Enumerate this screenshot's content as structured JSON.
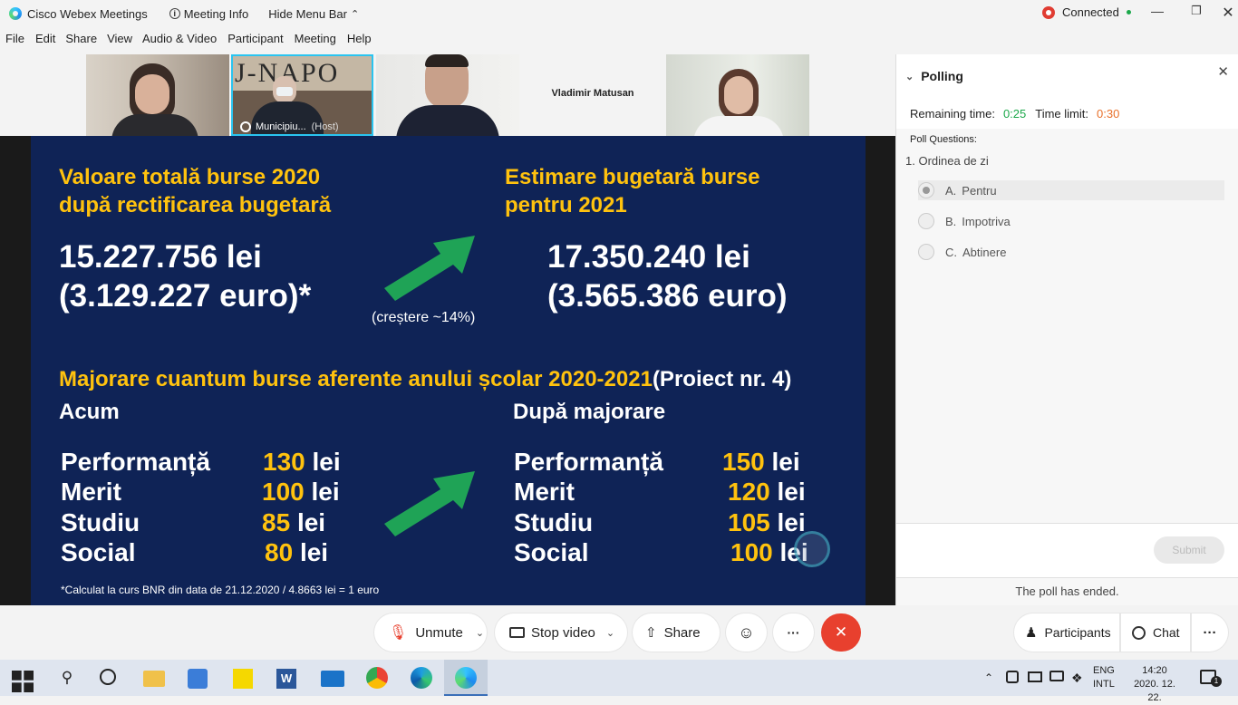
{
  "titlebar": {
    "app_title": "Cisco Webex Meetings",
    "meeting_info": "Meeting Info",
    "hide_menu": "Hide Menu Bar",
    "status": "Connected"
  },
  "menu": [
    "File",
    "Edit",
    "Share",
    "View",
    "Audio & Video",
    "Participant",
    "Meeting",
    "Help"
  ],
  "participants": {
    "host_name": "Municipiu...",
    "host_tag": "(Host)",
    "name_tile": "Vladimir Matusan"
  },
  "slide": {
    "h_left_1": "Valoare totală burse 2020",
    "h_left_2": "după rectificarea bugetară",
    "h_right_1": "Estimare bugetară burse",
    "h_right_2": "pentru 2021",
    "val_left_1": "15.227.756 lei",
    "val_left_2": "(3.129.227 euro)*",
    "growth": "(creștere ~14%)",
    "val_right_1": "17.350.240 lei",
    "val_right_2": "(3.565.386 euro)",
    "maj_title": "Majorare cuantum burse aferente anului școlar 2020-2021",
    "maj_proj": "(Proiect nr. 4)",
    "now": "Acum",
    "after": "După majorare",
    "currency": "lei",
    "rows_now": [
      {
        "label": "Performanță",
        "amount": "130"
      },
      {
        "label": "Merit",
        "amount": "100"
      },
      {
        "label": "Studiu",
        "amount": "85"
      },
      {
        "label": "Social",
        "amount": "80"
      }
    ],
    "rows_after": [
      {
        "label": "Performanță",
        "amount": "150"
      },
      {
        "label": "Merit",
        "amount": "120"
      },
      {
        "label": "Studiu",
        "amount": "105"
      },
      {
        "label": "Social",
        "amount": "100"
      }
    ],
    "footnote": "*Calculat la curs BNR din data de 21.12.2020 / 4.8663 lei = 1 euro"
  },
  "poll": {
    "title": "Polling",
    "remaining_label": "Remaining time:",
    "remaining_value": "0:25",
    "limit_label": "Time limit:",
    "limit_value": "0:30",
    "questions_label": "Poll Questions:",
    "question": "1.  Ordinea de zi",
    "options": [
      {
        "key": "A.",
        "text": "Pentru"
      },
      {
        "key": "B.",
        "text": "Impotriva"
      },
      {
        "key": "C.",
        "text": "Abtinere"
      }
    ],
    "submit": "Submit",
    "ended": "The poll has ended."
  },
  "toolbar": {
    "unmute": "Unmute",
    "stop_video": "Stop video",
    "share": "Share",
    "more": "···",
    "participants": "Participants",
    "chat": "Chat"
  },
  "taskbar": {
    "lang1": "ENG",
    "lang2": "INTL",
    "time": "14:20",
    "date": "2020. 12. 22.",
    "notif": "1"
  },
  "colors": {
    "slide_bg": "#0f2356",
    "accent_yellow": "#ffc20e",
    "arrow_green": "#1fa356",
    "end_red": "#e8402e",
    "green_text": "#1ba84a",
    "orange_text": "#e8702a"
  }
}
